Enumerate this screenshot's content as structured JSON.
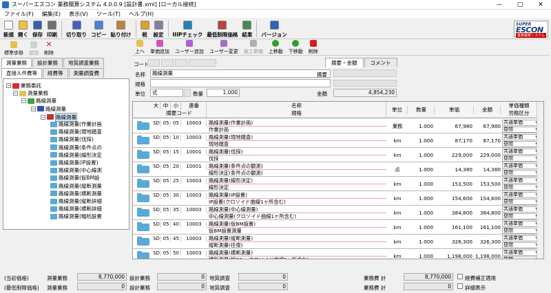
{
  "window": {
    "title": "スーパーエスコン 業務積算システム 4.0.0.9 [設計書.xml] [ローカル接続]",
    "min": "—",
    "max": "▢",
    "close": "✕"
  },
  "menu": [
    "ファイル(F)",
    "編集(E)",
    "表示(V)",
    "ツール(T)",
    "ヘルプ(H)"
  ],
  "toolbar": [
    {
      "label": "新規",
      "icon": "new-icon",
      "color": "#ffffff"
    },
    {
      "label": "開く",
      "icon": "open-icon",
      "color": "#f0c040"
    },
    {
      "label": "保存",
      "icon": "save-icon",
      "color": "#3a5fa8"
    },
    {
      "label": "印刷",
      "icon": "print-icon",
      "color": "#707070"
    },
    {
      "label": "切り取り",
      "icon": "cut-icon",
      "color": "#4060c0"
    },
    {
      "label": "コピー",
      "icon": "copy-icon",
      "color": "#5080d0"
    },
    {
      "label": "貼り付け",
      "icon": "paste-icon",
      "color": "#c08040"
    },
    {
      "label": "税",
      "icon": "tax-icon",
      "color": "#e0a030"
    },
    {
      "label": "設定",
      "icon": "settings-icon",
      "color": "#8080a0"
    },
    {
      "label": "IIIPチェック",
      "icon": "check-icon",
      "color": "#2080c0"
    },
    {
      "label": "最低制限価格",
      "icon": "price-icon",
      "color": "#c04040"
    },
    {
      "label": "結果",
      "icon": "result-icon",
      "color": "#4a8a4a"
    },
    {
      "label": "バージョン",
      "icon": "help-icon",
      "color": "#3060c0"
    }
  ],
  "logo": {
    "line1": "SUPER",
    "line2": "ESCON",
    "line3": "業務積算システム"
  },
  "left_toolbar": [
    {
      "label": "標準歩掛",
      "icon": "folder-open-icon"
    },
    {
      "label": "追加",
      "icon": "add-icon"
    },
    {
      "label": "削除",
      "icon": "delete-icon"
    }
  ],
  "left_tabs1": [
    "測量業務",
    "設計業務",
    "地質調査業務"
  ],
  "left_tabs2": [
    "直接人件費等",
    "経費等",
    "測量調査費"
  ],
  "tree": [
    {
      "label": "業務委託",
      "level": 0,
      "color": "#d03030"
    },
    {
      "label": "測量業務",
      "level": 1,
      "color": "#e0c060"
    },
    {
      "label": "路線測量",
      "level": 2,
      "color": "#40a040"
    },
    {
      "label": "路線測量",
      "level": 3,
      "color": "#3050b0"
    },
    {
      "label": "路線測量",
      "level": 4,
      "color": "#c03030",
      "selected": true
    },
    {
      "label": "路線測量(作業計画",
      "level": 5,
      "color": "#5aa9d6"
    },
    {
      "label": "路線測量(現地踏査",
      "level": 5,
      "color": "#5aa9d6"
    },
    {
      "label": "路線測量(伐採)",
      "level": 5,
      "color": "#5aa9d6"
    },
    {
      "label": "路線測量(条件点の",
      "level": 5,
      "color": "#5aa9d6"
    },
    {
      "label": "路線測量(線形決定",
      "level": 5,
      "color": "#5aa9d6"
    },
    {
      "label": "路線測量(IP設置)",
      "level": 5,
      "color": "#5aa9d6"
    },
    {
      "label": "路線測量(中心線測",
      "level": 5,
      "color": "#5aa9d6"
    },
    {
      "label": "路線測量(仮BM設",
      "level": 5,
      "color": "#5aa9d6"
    },
    {
      "label": "路線測量(縦断測量",
      "level": 5,
      "color": "#5aa9d6"
    },
    {
      "label": "路線測量(横断測量",
      "level": 5,
      "color": "#5aa9d6"
    },
    {
      "label": "路線測量(縦断詳細",
      "level": 5,
      "color": "#5aa9d6"
    },
    {
      "label": "路線測量(横断詳細",
      "level": 5,
      "color": "#5aa9d6"
    },
    {
      "label": "路線測量(幅杭設置",
      "level": 5,
      "color": "#5aa9d6"
    }
  ],
  "right_toolbar": [
    "上へ",
    "単価追加",
    "ユーザー追加",
    "ユーザー変更",
    "施工単価",
    "上移動",
    "下移動",
    "削除"
  ],
  "form": {
    "code_label": "コード",
    "name_label": "名称",
    "name_value": "路線測量",
    "spec_label": "規格",
    "unit_label": "単位",
    "unit_value": "式",
    "qty_label": "数量",
    "qty_value": "1.000",
    "summary_label": "摘要",
    "amount_label": "金額",
    "amount_value": "4,854,230",
    "tab_summary": "摘要・金額",
    "tab_comment": "コメント"
  },
  "grid": {
    "headers": {
      "dai": "大",
      "chu": "中",
      "sho": "小",
      "seq": "連番",
      "summary_code": "摘要コード",
      "name": "名称",
      "spec": "規格",
      "unit": "単位",
      "qty": "数量",
      "price": "単価",
      "amount": "金額",
      "price_type": "単価種類",
      "labor": "労務区分"
    },
    "rows": [
      {
        "c1": "SD",
        "c2": "05",
        "c3": "05",
        "seq": "10003",
        "name": "路線測量(作業計画)",
        "spec": "作業計画",
        "unit": "業務",
        "qty": "1.000",
        "price": "67,980",
        "amount": "67,980",
        "t1": "共通単価",
        "t2": "昼間"
      },
      {
        "c1": "SD",
        "c2": "05",
        "c3": "10",
        "seq": "10003",
        "name": "路線測量(現地踏査)",
        "spec": "現地踏査",
        "unit": "km",
        "qty": "1.000",
        "price": "87,170",
        "amount": "87,170",
        "t1": "共通単価",
        "t2": "昼間"
      },
      {
        "c1": "SD",
        "c2": "05",
        "c3": "15",
        "seq": "10001",
        "name": "路線測量(伐採)",
        "spec": "伐採",
        "unit": "km",
        "qty": "1.000",
        "price": "229,000",
        "amount": "229,000",
        "t1": "共通単価",
        "t2": "昼間"
      },
      {
        "c1": "SD",
        "c2": "05",
        "c3": "20",
        "seq": "10001",
        "name": "路線測量(条件点の観測)",
        "spec": "線形決定(条件点の観測)",
        "unit": "点",
        "qty": "1.000",
        "price": "14,380",
        "amount": "14,380",
        "t1": "共通単価",
        "t2": "昼間"
      },
      {
        "c1": "SD",
        "c2": "05",
        "c3": "25",
        "seq": "10003",
        "name": "路線測量(線形決定)",
        "spec": "線形決定",
        "unit": "km",
        "qty": "1.000",
        "price": "153,500",
        "amount": "153,500",
        "t1": "共通単価",
        "t2": "昼間"
      },
      {
        "c1": "SD",
        "c2": "05",
        "c3": "30",
        "seq": "10003",
        "name": "路線測量(IP設置)",
        "spec": "IP設置(クロソイド曲線1ヶ所含む)",
        "unit": "km",
        "qty": "1.000",
        "price": "154,600",
        "amount": "154,600",
        "t1": "共通単価",
        "t2": "昼間"
      },
      {
        "c1": "SD",
        "c2": "05",
        "c3": "35",
        "seq": "10003",
        "name": "路線測量(中心線測量)",
        "spec": "中心線測量(クロソイド曲線1ヶ所含む)",
        "unit": "km",
        "qty": "1.000",
        "price": "384,800",
        "amount": "384,800",
        "t1": "共通単価",
        "t2": "昼間"
      },
      {
        "c1": "SD",
        "c2": "05",
        "c3": "40",
        "seq": "10003",
        "name": "路線測量(仮BM設置)",
        "spec": "仮BM設置測量",
        "unit": "km",
        "qty": "1.000",
        "price": "161,100",
        "amount": "161,100",
        "t1": "共通単価",
        "t2": "昼間"
      },
      {
        "c1": "SD",
        "c2": "05",
        "c3": "45",
        "seq": "10003",
        "name": "路線測量(縦断測量)",
        "spec": "縦断測量(往復)",
        "unit": "km",
        "qty": "1.000",
        "price": "326,300",
        "amount": "326,300",
        "t1": "共通単価",
        "t2": "昼間"
      },
      {
        "c1": "SD",
        "c2": "05",
        "c3": "50",
        "seq": "10003",
        "name": "路線測量(横断測量)",
        "spec": "横断測量(幅60m クロソイド曲線1ヶ所含む)",
        "unit": "km",
        "qty": "1.000",
        "price": "1,198,000",
        "amount": "1,198,000",
        "t1": "共通単価",
        "t2": "昼間"
      }
    ]
  },
  "footer": {
    "row1": {
      "label": "(当初価格)",
      "survey_label": "測量業務",
      "survey_value": "8,770,000",
      "design_label": "設計業務",
      "design_value": "0",
      "geo_label": "地質調査",
      "geo_value": "0",
      "total_label": "業務費 計",
      "total_value": "8,770,000",
      "check_label": "経費補正適用"
    },
    "row2": {
      "label": "(最低制限価格)",
      "survey_label": "測量業務",
      "survey_value": "0",
      "design_label": "設計業務",
      "design_value": "0",
      "geo_label": "地質調査",
      "geo_value": "0",
      "total_label": "業務費 計",
      "total_value": "0",
      "check_label": "詳細表示"
    }
  }
}
